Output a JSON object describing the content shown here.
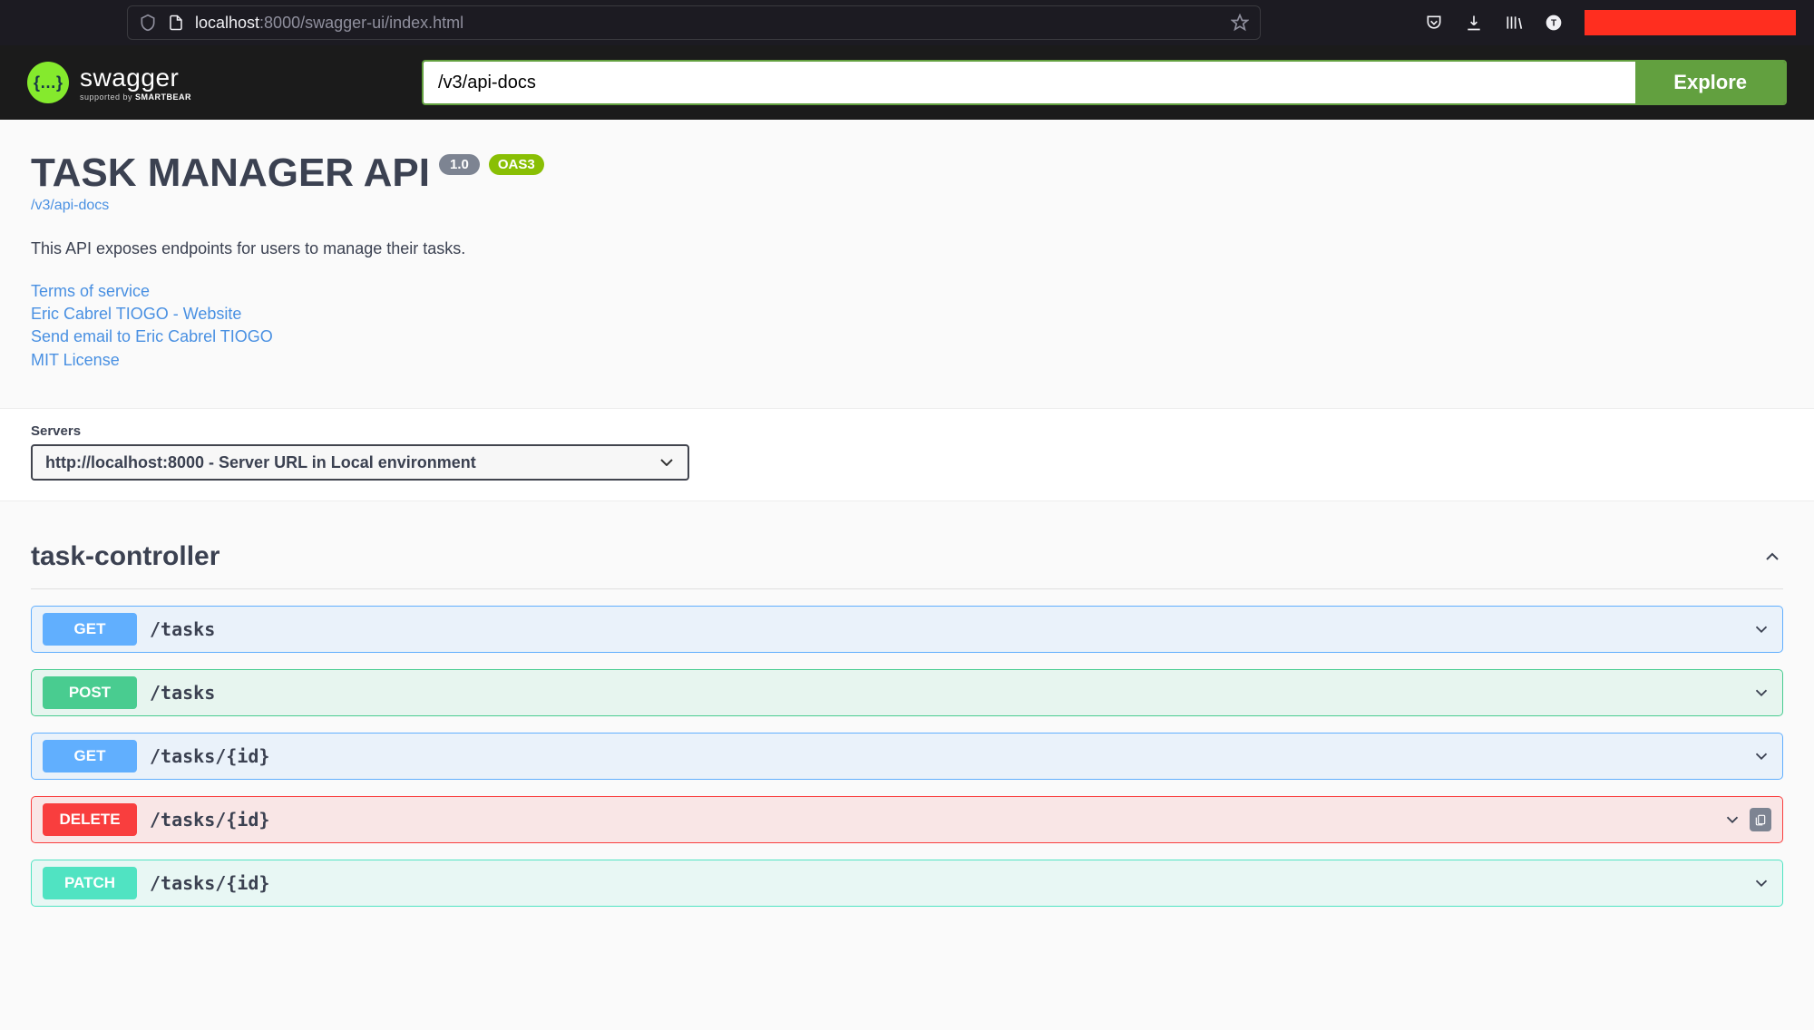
{
  "browser": {
    "url_gray_prefix": "localhost",
    "url_rest": ":8000/swagger-ui/index.html"
  },
  "topbar": {
    "logo_main": "swagger",
    "logo_sub_pre": "supported by ",
    "logo_sub_bold": "SMARTBEAR",
    "input_value": "/v3/api-docs",
    "explore_label": "Explore"
  },
  "info": {
    "title": "TASK MANAGER API",
    "version": "1.0",
    "oas": "OAS3",
    "spec_link": "/v3/api-docs",
    "description": "This API exposes endpoints for users to manage their tasks.",
    "links": {
      "tos": "Terms of service",
      "contact_site": "Eric Cabrel TIOGO - Website",
      "contact_email": "Send email to Eric Cabrel TIOGO",
      "license": "MIT License"
    }
  },
  "servers": {
    "label": "Servers",
    "selected": "http://localhost:8000 - Server URL in Local environment"
  },
  "tag": {
    "name": "task-controller",
    "operations": [
      {
        "method": "GET",
        "path": "/tasks",
        "cls": "op-get"
      },
      {
        "method": "POST",
        "path": "/tasks",
        "cls": "op-post"
      },
      {
        "method": "GET",
        "path": "/tasks/{id}",
        "cls": "op-get"
      },
      {
        "method": "DELETE",
        "path": "/tasks/{id}",
        "cls": "op-delete",
        "copy": true
      },
      {
        "method": "PATCH",
        "path": "/tasks/{id}",
        "cls": "op-patch"
      }
    ]
  }
}
